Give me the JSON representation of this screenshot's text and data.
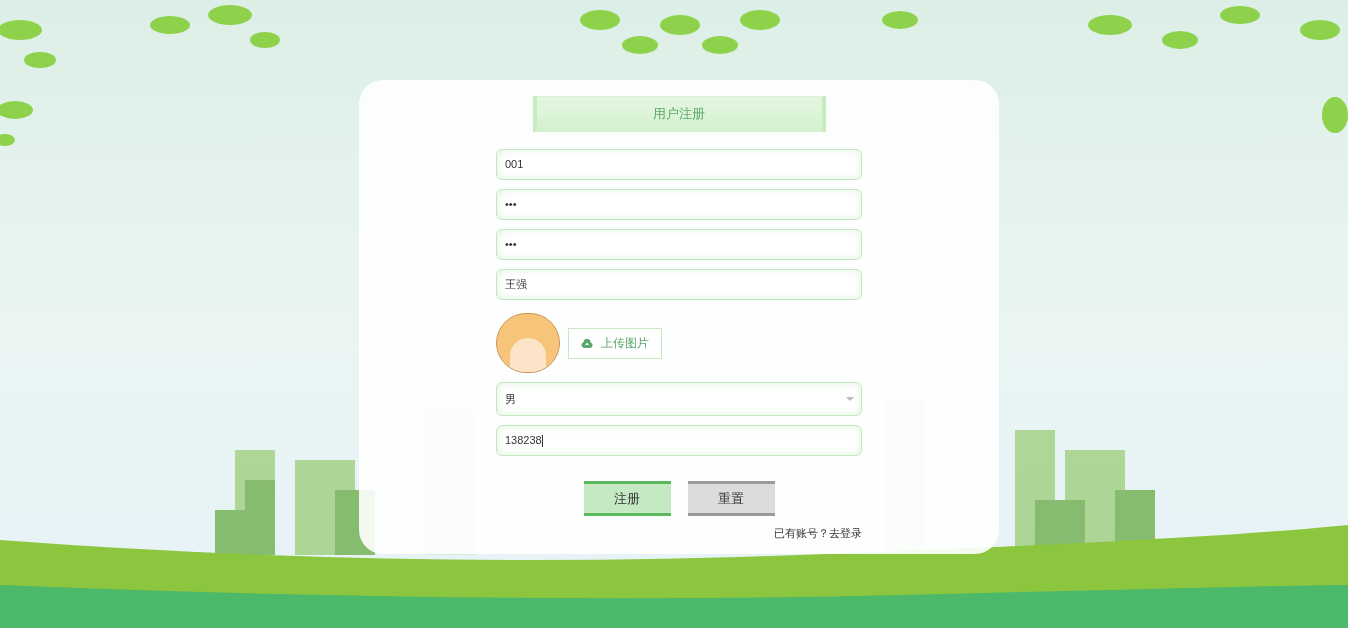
{
  "title": "用户注册",
  "fields": [
    {
      "value": "001"
    },
    {
      "value": "•••"
    },
    {
      "value": "•••"
    },
    {
      "value": "王强"
    }
  ],
  "upload": {
    "label": "上传图片"
  },
  "gender": {
    "value": "男"
  },
  "phone": {
    "value": "138238"
  },
  "buttons": [
    {
      "kind": "primary",
      "label": "注册"
    },
    {
      "kind": "secondary",
      "label": "重置"
    }
  ],
  "footer": {
    "prompt": "已有账号？",
    "link": "去登录"
  }
}
